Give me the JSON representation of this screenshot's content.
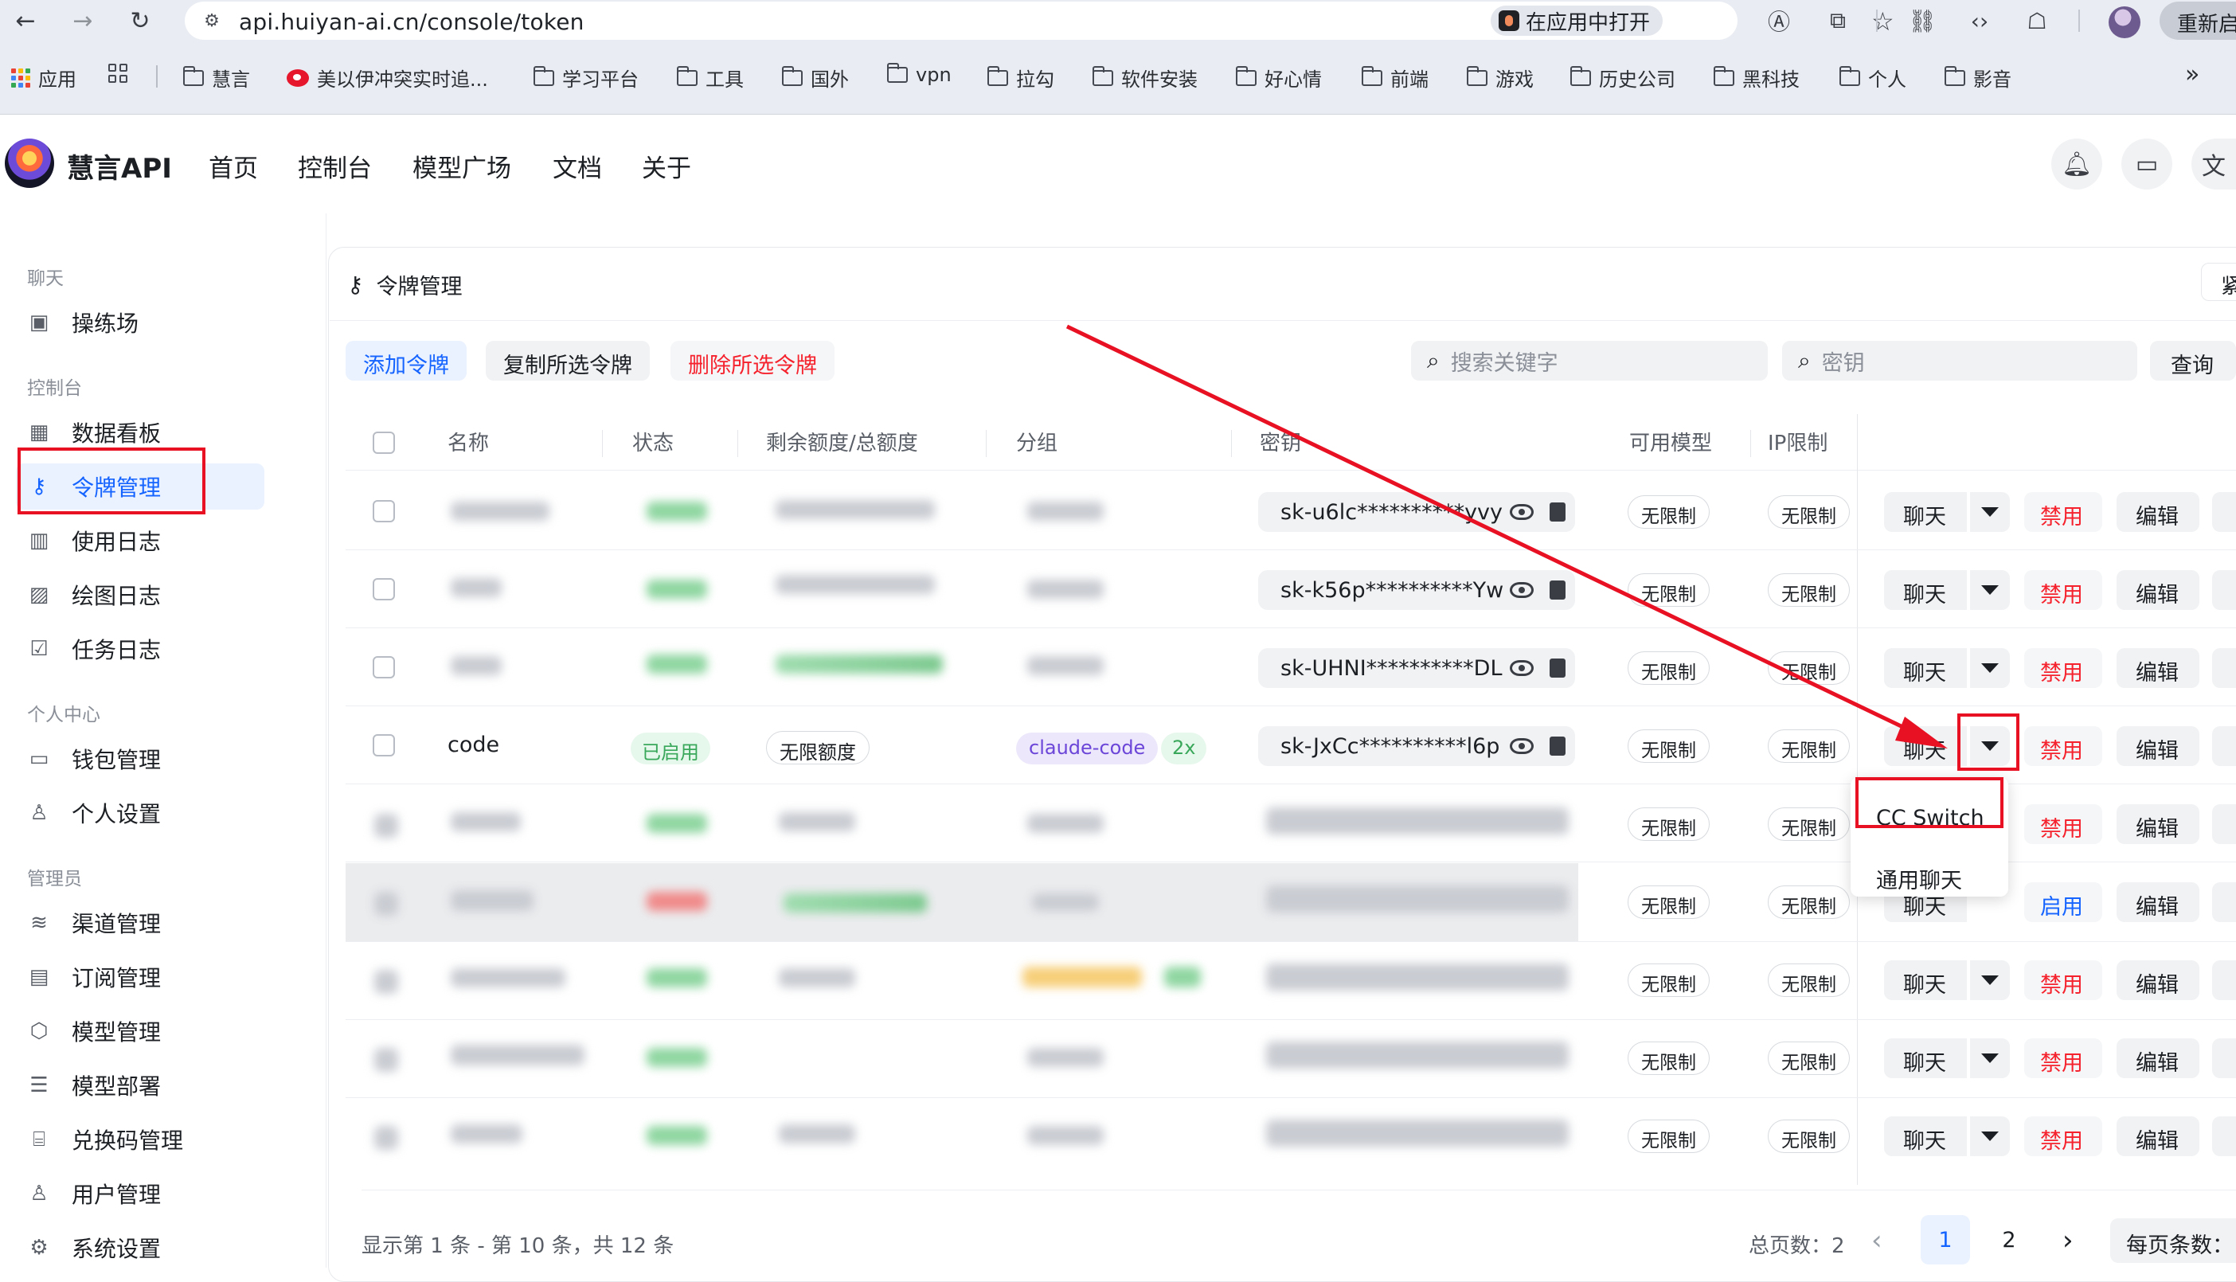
{
  "browser": {
    "url": "api.huiyan-ai.cn/console/token",
    "open_in_app": "在应用中打开",
    "relaunch": "重新启"
  },
  "bookmarks": [
    "应用",
    "慧言",
    "美以伊冲突实时追...",
    "学习平台",
    "工具",
    "国外",
    "vpn",
    "拉勾",
    "软件安装",
    "好心情",
    "前端",
    "游戏",
    "历史公司",
    "黑科技",
    "个人",
    "影音"
  ],
  "header": {
    "brand": "慧言API",
    "menu": [
      "首页",
      "控制台",
      "模型广场",
      "文档",
      "关于"
    ]
  },
  "sidebar": {
    "groups": [
      "聊天",
      "控制台",
      "个人中心",
      "管理员"
    ],
    "items": [
      "操练场",
      "数据看板",
      "令牌管理",
      "使用日志",
      "绘图日志",
      "任务日志",
      "钱包管理",
      "个人设置",
      "渠道管理",
      "订阅管理",
      "模型管理",
      "模型部署",
      "兑换码管理",
      "用户管理",
      "系统设置"
    ]
  },
  "page": {
    "title": "令牌管理",
    "corner": "紧",
    "actions": {
      "add": "添加令牌",
      "copy": "复制所选令牌",
      "delete": "删除所选令牌"
    },
    "search_placeholder": "搜索关键字",
    "key_placeholder": "密钥",
    "query": "查询"
  },
  "table": {
    "columns": [
      "名称",
      "状态",
      "剩余额度/总额度",
      "分组",
      "密钥",
      "可用模型",
      "IP限制"
    ],
    "keys": [
      "sk-u6lc**********yvy",
      "sk-k56p**********Yw",
      "sk-UHNI**********DL",
      "sk-JxCc**********l6p"
    ],
    "code_row": {
      "name": "code",
      "status": "已启用",
      "quota": "无限额度",
      "group": "claude-code",
      "ratio": "2x"
    },
    "unlimited": "无限制",
    "chat": "聊天",
    "disable": "禁用",
    "enable": "启用",
    "edit": "编辑"
  },
  "dropdown": {
    "items": [
      "CC Switch",
      "通用聊天"
    ]
  },
  "footer": {
    "info": "显示第 1 条 - 第 10 条，共 12 条",
    "total_pages_label": "总页数：",
    "total_pages": "2",
    "pages": [
      "1",
      "2"
    ],
    "per_page": "每页条数："
  },
  "colors": {
    "accent": "#1664ff",
    "danger": "#f5222d",
    "annotation": "#e81123"
  }
}
